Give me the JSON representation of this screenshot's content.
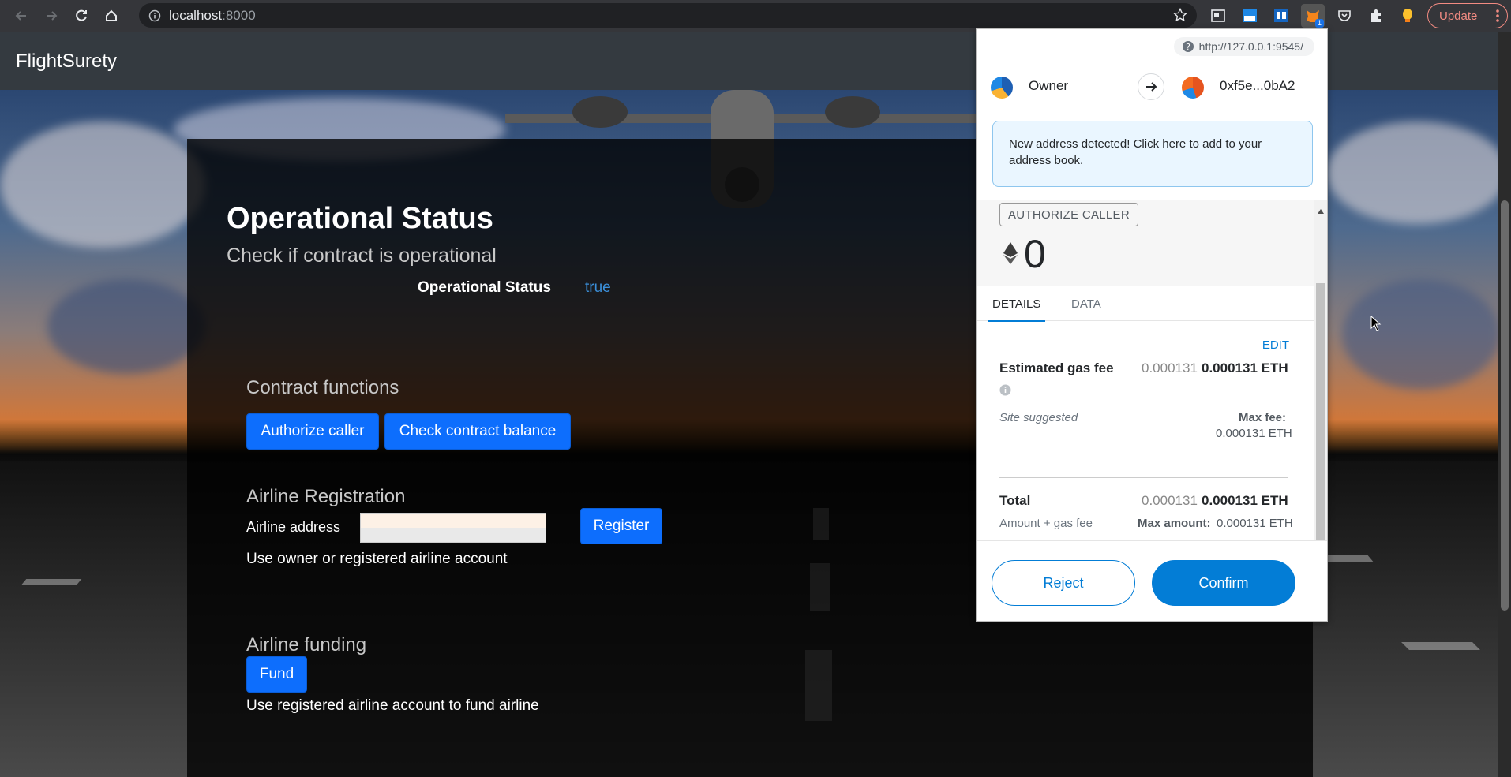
{
  "browser": {
    "url_host": "localhost",
    "url_port": ":8000",
    "update_label": "Update",
    "ext_badge": "1"
  },
  "app": {
    "brand": "FlightSurety"
  },
  "operational": {
    "title": "Operational Status",
    "subtitle": "Check if contract is operational",
    "status_label": "Operational Status",
    "status_value": "true"
  },
  "contract_functions": {
    "title": "Contract functions",
    "authorize_label": "Authorize caller",
    "balance_label": "Check contract balance"
  },
  "registration": {
    "title": "Airline Registration",
    "address_label": "Airline address",
    "address_value": "",
    "register_label": "Register",
    "hint": "Use owner or registered airline account"
  },
  "funding": {
    "title": "Airline funding",
    "fund_label": "Fund",
    "hint": "Use registered airline account to fund airline"
  },
  "metamask": {
    "origin": "http://127.0.0.1:9545/",
    "from_account": "Owner",
    "to_account": "0xf5e...0bA2",
    "notice": "New address detected! Click here to add to your address book.",
    "method": "AUTHORIZE CALLER",
    "amount": "0",
    "tabs": [
      "DETAILS",
      "DATA"
    ],
    "edit": "EDIT",
    "gas_label": "Estimated gas fee",
    "gas_grey": "0.000131",
    "gas_bold": "0.000131 ETH",
    "site_suggested": "Site suggested",
    "max_fee_label": "Max fee:",
    "max_fee_value": "0.000131 ETH",
    "total_label": "Total",
    "total_grey": "0.000131",
    "total_bold": "0.000131 ETH",
    "amount_gas": "Amount + gas fee",
    "max_amount_label": "Max amount:",
    "max_amount_value": "0.000131 ETH",
    "reject": "Reject",
    "confirm": "Confirm"
  },
  "icons": {
    "back": "arrow-left-icon",
    "forward": "arrow-right-icon",
    "reload": "reload-icon",
    "home": "home-icon",
    "info": "info-icon",
    "star": "star-icon",
    "metamask": "fox-icon"
  },
  "colors": {
    "primary_button": "#0d6efd",
    "metamask_blue": "#037dd6",
    "status_true": "#3b8fd9"
  }
}
